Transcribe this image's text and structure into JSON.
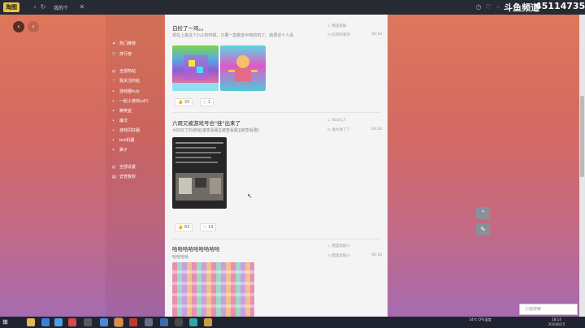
{
  "titlebar": {
    "logo": "淘图",
    "tab_label": "我的个",
    "live_text": "斗鱼频道",
    "live_id": "45114735"
  },
  "sidebar": {
    "items": [
      {
        "icon": "fire-icon",
        "label": "热门推荐"
      },
      {
        "icon": "chart-icon",
        "label": "排行榜"
      },
      {
        "icon": "grid-icon",
        "label": "全部热帖"
      },
      {
        "icon": "heart-icon",
        "label": "我关注的帖"
      },
      {
        "icon": "dot-icon",
        "label": "游戏圈hub"
      },
      {
        "icon": "dot-icon",
        "label": "一起小游戏(xD)"
      },
      {
        "icon": "dot-icon",
        "label": "精英室"
      },
      {
        "icon": "dot-icon",
        "label": "魔法"
      },
      {
        "icon": "dot-icon",
        "label": "游戏同好圈"
      },
      {
        "icon": "dot-icon",
        "label": "bot机器"
      },
      {
        "icon": "dot-icon",
        "label": "聚子"
      },
      {
        "icon": "settings-icon",
        "label": "全部设置"
      },
      {
        "icon": "user-icon",
        "label": "去管板权"
      }
    ]
  },
  "posts": [
    {
      "title": "白捡了一鸡。。",
      "subtitle": "现在上来这个1v1的时候，只要一直跑蓝半吧的鸡了，结果这十人杀",
      "author": "我是高级",
      "meta": "吃鸡的某功",
      "time": "06:18",
      "likes": "33",
      "comments": "1"
    },
    {
      "title": "六周又被游戏号也\"挂\"出来了",
      "subtitle": "大好玩了的游戏[被查看跟][被查看跟][被查看跟]",
      "author": "Nao九人",
      "meta": "发片进了了",
      "time": "06:18",
      "likes": "83",
      "comments": "19"
    },
    {
      "title": "哈哈哈哈哈哈哈哈哈",
      "subtitle": "哈哈哈哈",
      "author": "我是高级小",
      "meta": "我是高级小",
      "time": "06:18"
    }
  ],
  "float": {
    "up_icon": "chevron-up-icon",
    "edit_icon": "edit-icon"
  },
  "search": {
    "placeholder": "小窗搜索"
  },
  "tray": {
    "weather": "24℃ CPU温度",
    "time": "18:14",
    "date": "2020/6/15"
  },
  "colors": {
    "accent": "#f2c33b",
    "bg_top": "#e0785b",
    "bg_bottom": "#a26bb5"
  }
}
